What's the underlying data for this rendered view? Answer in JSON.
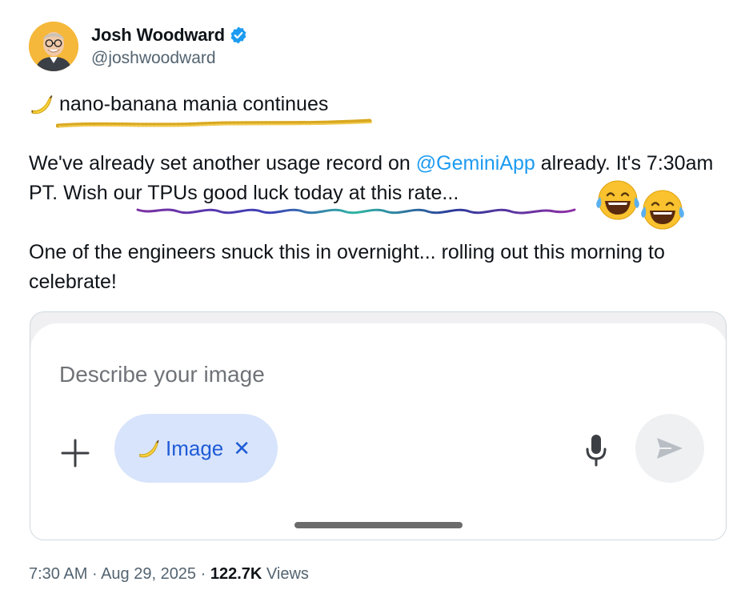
{
  "author": {
    "display_name": "Josh Woodward",
    "handle": "@joshwoodward",
    "verified": true,
    "avatar_bg": "#f5b83a"
  },
  "tweet": {
    "headline_emoji": "banana-icon",
    "headline": "nano-banana mania continues",
    "p1_before": "We've already set another usage record on ",
    "p1_mention": "@GeminiApp",
    "p1_after": " already. It's 7:30am PT. Wish our TPUs good luck today at this rate...",
    "p2": "One of the engineers snuck this in overnight... rolling out this morning to celebrate!",
    "reaction_emoji": "laughing-tears-icon"
  },
  "embedded_ui": {
    "prompt_placeholder": "Describe your image",
    "chip_label": "Image",
    "chip_close": "✕",
    "chip_bg": "#d8e4fb",
    "chip_color": "#1f5bd6"
  },
  "meta": {
    "time": "7:30 AM",
    "date": "Aug 29, 2025",
    "views_count": "122.7K",
    "views_label": "Views",
    "separator": " · "
  },
  "colors": {
    "link": "#1d9bf0",
    "secondary_text": "#536471",
    "verified": "#1d9bf0"
  }
}
